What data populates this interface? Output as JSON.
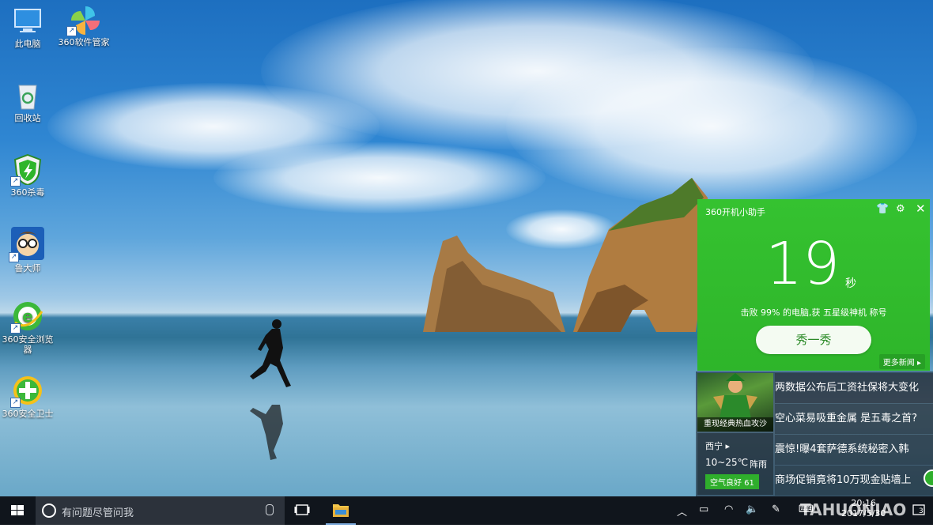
{
  "desktop": {
    "icons": [
      {
        "label": "此电脑",
        "icon": "this-pc-icon"
      },
      {
        "label": "360软件管家",
        "icon": "360-software-manager-icon"
      },
      {
        "label": "回收站",
        "icon": "recycle-bin-icon"
      },
      {
        "label": "360杀毒",
        "icon": "360-antivirus-icon"
      },
      {
        "label": "鲁大师",
        "icon": "ludashi-icon"
      },
      {
        "label": "360安全浏览器",
        "icon": "360-browser-icon"
      },
      {
        "label": "360安全卫士",
        "icon": "360-security-guard-icon"
      }
    ]
  },
  "helper": {
    "title": "360开机小助手",
    "boot_seconds": "19",
    "unit": "秒",
    "description": "击败 99% 的电脑,获 五星级神机 称号",
    "show_button": "秀一秀",
    "more_news": "更多新闻 ▸"
  },
  "news": {
    "thumb_caption": "重现经典热血攻沙",
    "weather": {
      "city": "西宁",
      "temp": "10~25℃",
      "condition": "阵雨",
      "air_quality": "空气良好 61"
    },
    "items": [
      "两数据公布后工资社保将大变化",
      "空心菜易吸重金属 是五毒之首?",
      "震惊!曝4套萨德系统秘密入韩",
      "商场促销竟将10万现金贴墙上"
    ]
  },
  "taskbar": {
    "search_placeholder": "有问题尽管问我",
    "clock_time": "20:16",
    "clock_date": "2017/5/30",
    "notification_count": "3"
  },
  "watermark": "TAHUONIAO",
  "colors": {
    "helper_green": "#2eb52a",
    "taskbar": "#10151c"
  }
}
